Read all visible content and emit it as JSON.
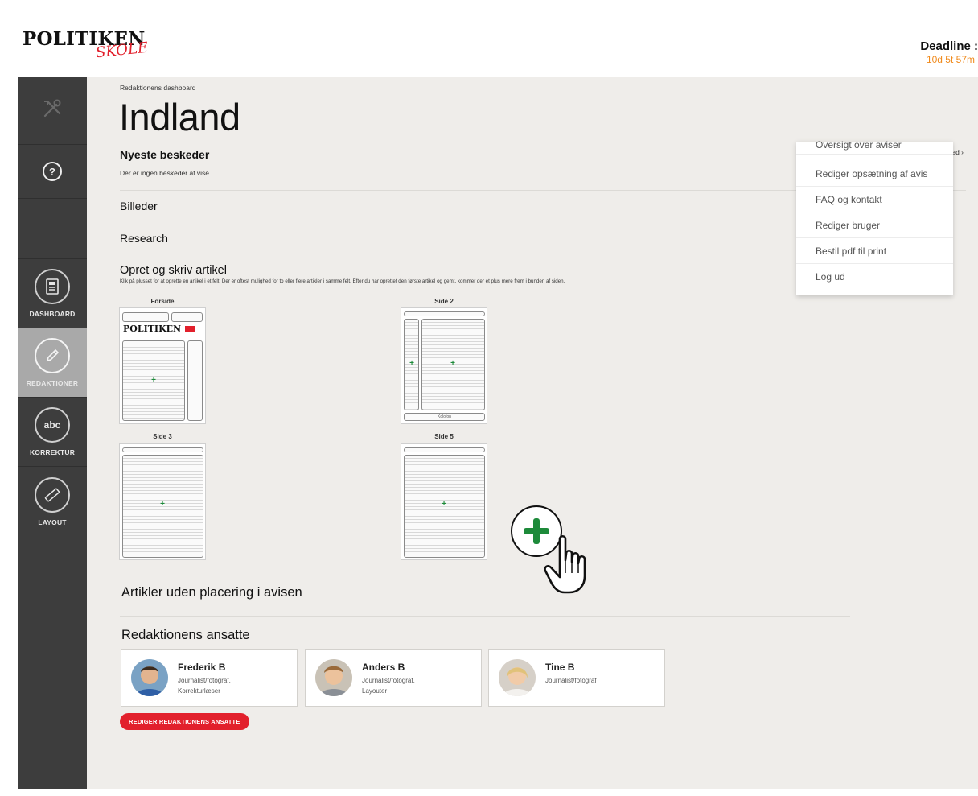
{
  "header": {
    "logo_main": "POLITIKEN",
    "logo_sub": "SKOLE",
    "deadline_label": "Deadline :",
    "deadline_value": "10d 5t 57m"
  },
  "sidebar": {
    "items": [
      {
        "label": "",
        "icon": "tools-icon"
      },
      {
        "label": "",
        "icon": "help-icon",
        "glyph": "?"
      },
      {
        "label": "DASHBOARD",
        "icon": "newspaper-icon"
      },
      {
        "label": "REDAKTIONER",
        "icon": "pencil-icon",
        "active": true
      },
      {
        "label": "KORREKTUR",
        "icon": "spellcheck-icon",
        "glyph": "abc"
      },
      {
        "label": "LAYOUT",
        "icon": "ruler-icon"
      }
    ]
  },
  "main": {
    "breadcrumb": "Redaktionens dashboard",
    "title": "Indland",
    "messages_title": "Nyeste beskeder",
    "messages_empty": "Der er ingen beskeder at vise",
    "write_message": "Skriv besked ›",
    "images_title": "Billeder",
    "research_title": "Research",
    "create_title": "Opret og skriv artikel",
    "create_hint": "Klik på plusset for at oprette en artikel i et felt. Der er oftest mulighed for to eller flere artikler i samme felt. Efter du har oprettet den første artikel og gemt, kommer der et plus mere frem i bunden af siden.",
    "pages": [
      {
        "label": "Forside"
      },
      {
        "label": "Side 2"
      },
      {
        "label": "Side 3"
      },
      {
        "label": "Side 5"
      }
    ],
    "mini_logo": "POLITIKEN",
    "kolofon": "Kolofon",
    "unplaced_title": "Artikler uden placering i avisen",
    "staff_title": "Redaktionens ansatte",
    "staff": [
      {
        "name": "Frederik B",
        "role_line1": "Journalist/fotograf,",
        "role_line2": "Korrekturlæser"
      },
      {
        "name": "Anders B",
        "role_line1": "Journalist/fotograf,",
        "role_line2": "Layouter"
      },
      {
        "name": "Tine B",
        "role_line1": "Journalist/fotograf",
        "role_line2": ""
      }
    ],
    "edit_staff_button": "REDIGER REDAKTIONENS ANSATTE"
  },
  "menu": {
    "items": [
      "Oversigt over aviser",
      "Rediger opsætning af avis",
      "FAQ og kontakt",
      "Rediger bruger",
      "Bestil pdf til print",
      "Log ud"
    ]
  },
  "colors": {
    "accent_red": "#e2202c",
    "deadline_orange": "#f08a1c",
    "plus_green": "#1d8a3a",
    "sidebar_bg": "#3d3d3d"
  }
}
